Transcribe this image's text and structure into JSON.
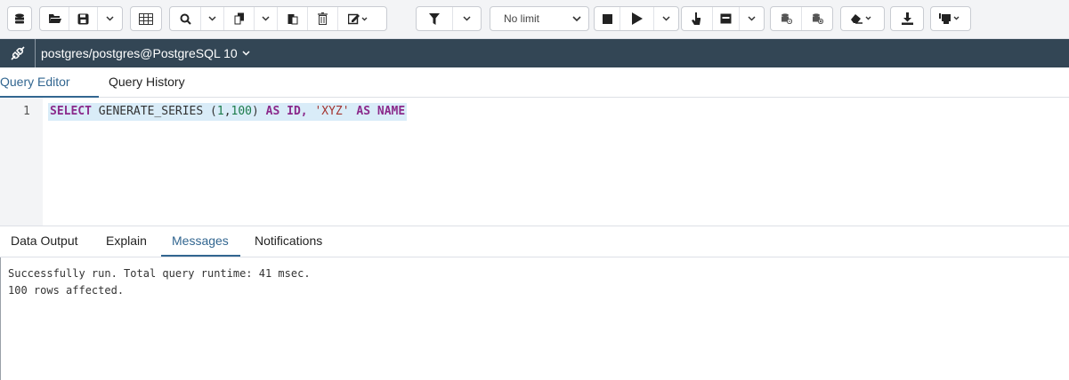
{
  "toolbar": {
    "limit_value": "No limit",
    "icons": [
      "database-icon",
      "open-folder-icon",
      "save-icon",
      "chevron-down-icon",
      "edit-grid-icon",
      "search-icon",
      "copy-icon",
      "paste-icon",
      "delete-icon",
      "edit-icon",
      "filter-icon",
      "stop-icon",
      "execute-icon",
      "explain-icon",
      "explain-analyze-icon",
      "commit-icon",
      "rollback-icon",
      "clear-icon",
      "download-icon",
      "macros-icon"
    ]
  },
  "connection": {
    "label": "postgres/postgres@PostgreSQL 10",
    "caret": "⌄"
  },
  "editor_tabs": {
    "query_editor": "Query Editor",
    "query_history": "Query History"
  },
  "editor": {
    "line_number": "1",
    "tokens": {
      "select": "SELECT",
      "func": "GENERATE_SERIES",
      "open": " (",
      "n1": "1",
      "comma": ",",
      "n2": "100",
      "close": ")",
      "as1": "AS",
      "id": "ID,",
      "str": "'XYZ'",
      "as2": "AS",
      "name": "NAME"
    }
  },
  "output_tabs": {
    "data_output": "Data Output",
    "explain": "Explain",
    "messages": "Messages",
    "notifications": "Notifications"
  },
  "messages": {
    "line1": "Successfully run. Total query runtime: 41 msec.",
    "line2": "100 rows affected."
  },
  "colors": {
    "accent": "#326690",
    "connbar": "#334655",
    "keyword": "#8b2a8b",
    "number": "#1c7b4a",
    "string": "#a3332f"
  }
}
